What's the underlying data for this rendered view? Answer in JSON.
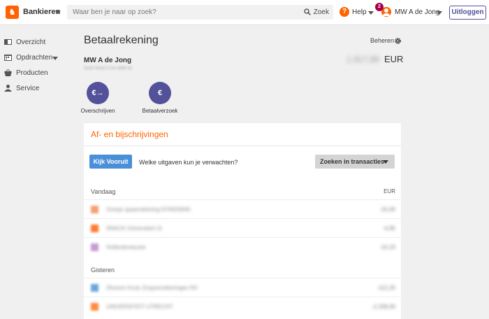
{
  "topbar": {
    "app_name": "Bankieren",
    "search_placeholder": "Waar ben je naar op zoek?",
    "search_button": "Zoek",
    "help_label": "Help",
    "notification_count": "2",
    "user_name": "MW A de Jong",
    "logout_label": "Uitloggen"
  },
  "sidebar": {
    "items": [
      {
        "label": "Overzicht",
        "icon": "overview-icon"
      },
      {
        "label": "Opdrachten",
        "icon": "calendar-icon"
      },
      {
        "label": "Producten",
        "icon": "basket-icon"
      },
      {
        "label": "Service",
        "icon": "person-icon"
      }
    ]
  },
  "account": {
    "title": "Betaalrekening",
    "manage_label": "Beheren",
    "holder": "MW A de Jong",
    "iban": "NL80 INGB 0755 4899 45",
    "balance": "1.917,99",
    "currency": "EUR"
  },
  "actions": [
    {
      "label": "Overschrijven",
      "icon": "transfer-icon",
      "glyph": "€→"
    },
    {
      "label": "Betaalverzoek",
      "icon": "payment-request-icon",
      "glyph": "€"
    }
  ],
  "transactions": {
    "title": "Af- en bijschrijvingen",
    "kijk_button": "Kijk Vooruit",
    "kijk_question": "Welke uitgaven kun je verwachten?",
    "search_button": "Zoeken in transacties",
    "currency_header": "EUR",
    "groups": [
      {
        "label": "Vandaag",
        "rows": [
          {
            "name": "Oranje spaarrekening N78426940",
            "amount": "-15,00",
            "color": "#f5a070"
          },
          {
            "name": "SNACK Universiteit Ut",
            "amount": "-4,95",
            "color": "#ff7a2e"
          },
          {
            "name": "Hollandsnieuwe",
            "amount": "-10,23",
            "color": "#c79bd3"
          }
        ]
      },
      {
        "label": "Gisteren",
        "rows": [
          {
            "name": "Zilveren Kruis Zorgverzekeringen NV",
            "amount": "-112,25",
            "color": "#6aa7dd"
          },
          {
            "name": "UNIVERSITEIT UTRECHT",
            "amount": "-2.209,00",
            "color": "#ff8a3d"
          }
        ]
      }
    ]
  }
}
